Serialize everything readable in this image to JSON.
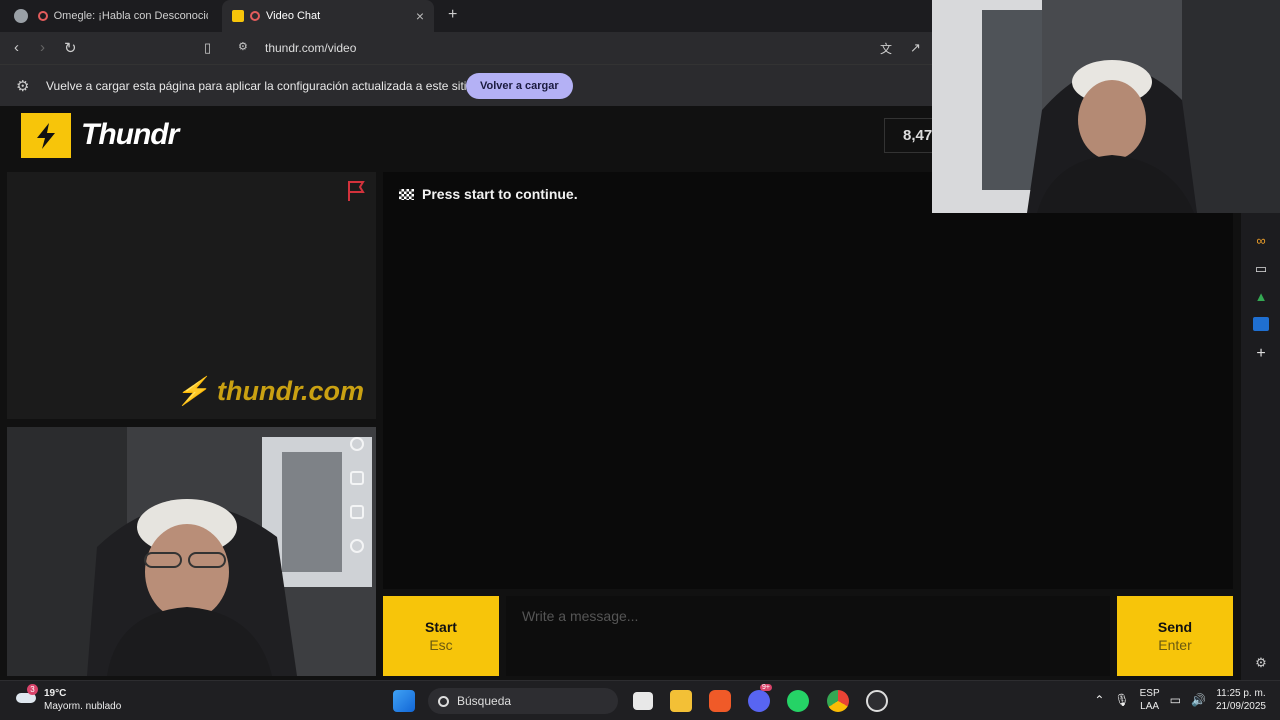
{
  "browser": {
    "tabs": [
      {
        "title": "Omegle: ¡Habla con Desconocido",
        "active": false
      },
      {
        "title": "Video Chat",
        "active": true
      }
    ],
    "url": "thundr.com/video",
    "infobar": {
      "message": "Vuelve a cargar esta página para aplicar la configuración actualizada a este sitio",
      "button": "Volver a cargar"
    }
  },
  "site": {
    "brand": "Thundr",
    "online_count": "8,47",
    "watermark": "⚡ thundr.com",
    "status_message": "Press start to continue.",
    "start_button": {
      "label": "Start",
      "shortcut": "Esc"
    },
    "send_button": {
      "label": "Send",
      "shortcut": "Enter"
    },
    "message_placeholder": "Write a message..."
  },
  "taskbar": {
    "weather": {
      "badge": "3",
      "temp": "19°C",
      "condition": "Mayorm. nublado"
    },
    "search_label": "Búsqueda",
    "lang_top": "ESP",
    "lang_bottom": "LAA",
    "time": "11:25 p. m.",
    "date": "21/09/2025",
    "discord_badge": "9+"
  },
  "colors": {
    "accent": "#f7c50a",
    "infobar_button": "#b4b1f5",
    "report_flag": "#d2323c"
  }
}
